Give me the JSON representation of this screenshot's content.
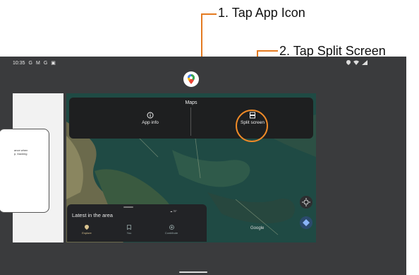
{
  "annotations": {
    "step1": "1. Tap App Icon",
    "step2": "2. Tap Split Screen",
    "accent": "#e47a20"
  },
  "statusbar": {
    "time": "10:35",
    "left_icons": [
      "G",
      "M",
      "G",
      "▣"
    ]
  },
  "left_app": {
    "text_line1": "ance when",
    "text_line2": "p, tracking"
  },
  "app_menu": {
    "title": "Maps",
    "app_info_label": "App info",
    "split_screen_label": "Split screen"
  },
  "bottom_sheet": {
    "title": "Latest in the area",
    "weather": "79°",
    "nav": [
      "Explore",
      "You",
      "Contribute"
    ]
  },
  "map": {
    "attribution": "Google"
  }
}
